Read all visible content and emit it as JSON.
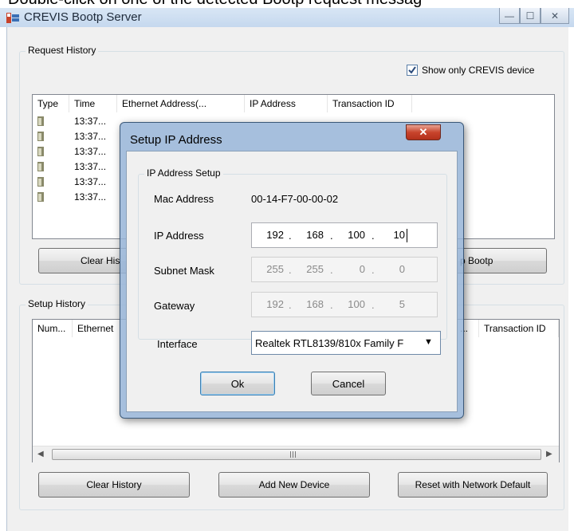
{
  "caption": "Double-click on one of the detected Bootp request messag",
  "window": {
    "title": "CREVIS Bootp Server",
    "minimize": "—",
    "maximize": "☐",
    "close": "✕"
  },
  "request_history": {
    "label": "Request History",
    "show_only_label": "Show only CREVIS device",
    "show_only_checked": true,
    "columns": [
      "Type",
      "Time",
      "Ethernet Address(...",
      "IP Address",
      "Transaction ID"
    ],
    "rows": [
      {
        "time": "13:37..."
      },
      {
        "time": "13:37..."
      },
      {
        "time": "13:37..."
      },
      {
        "time": "13:37..."
      },
      {
        "time": "13:37..."
      },
      {
        "time": "13:37..."
      }
    ],
    "buttons": {
      "clear": "Clear His",
      "stop": "p Bootp"
    }
  },
  "setup_history": {
    "label": "Setup History",
    "columns": [
      "Num...",
      "Ethernet",
      "...",
      "Transaction ID"
    ],
    "buttons": {
      "clear": "Clear History",
      "add": "Add New Device",
      "reset": "Reset with Network Default"
    }
  },
  "dialog": {
    "title": "Setup IP Address",
    "group_label": "IP Address Setup",
    "mac": {
      "label": "Mac Address",
      "value": "00-14-F7-00-00-02"
    },
    "ip": {
      "label": "IP Address",
      "o1": "192",
      "o2": "168",
      "o3": "100",
      "o4": "10"
    },
    "subnet": {
      "label": "Subnet Mask",
      "o1": "255",
      "o2": "255",
      "o3": "0",
      "o4": "0"
    },
    "gateway": {
      "label": "Gateway",
      "o1": "192",
      "o2": "168",
      "o3": "100",
      "o4": "5"
    },
    "interface": {
      "label": "Interface",
      "value": "Realtek RTL8139/810x Family F"
    },
    "ok": "Ok",
    "cancel": "Cancel"
  }
}
